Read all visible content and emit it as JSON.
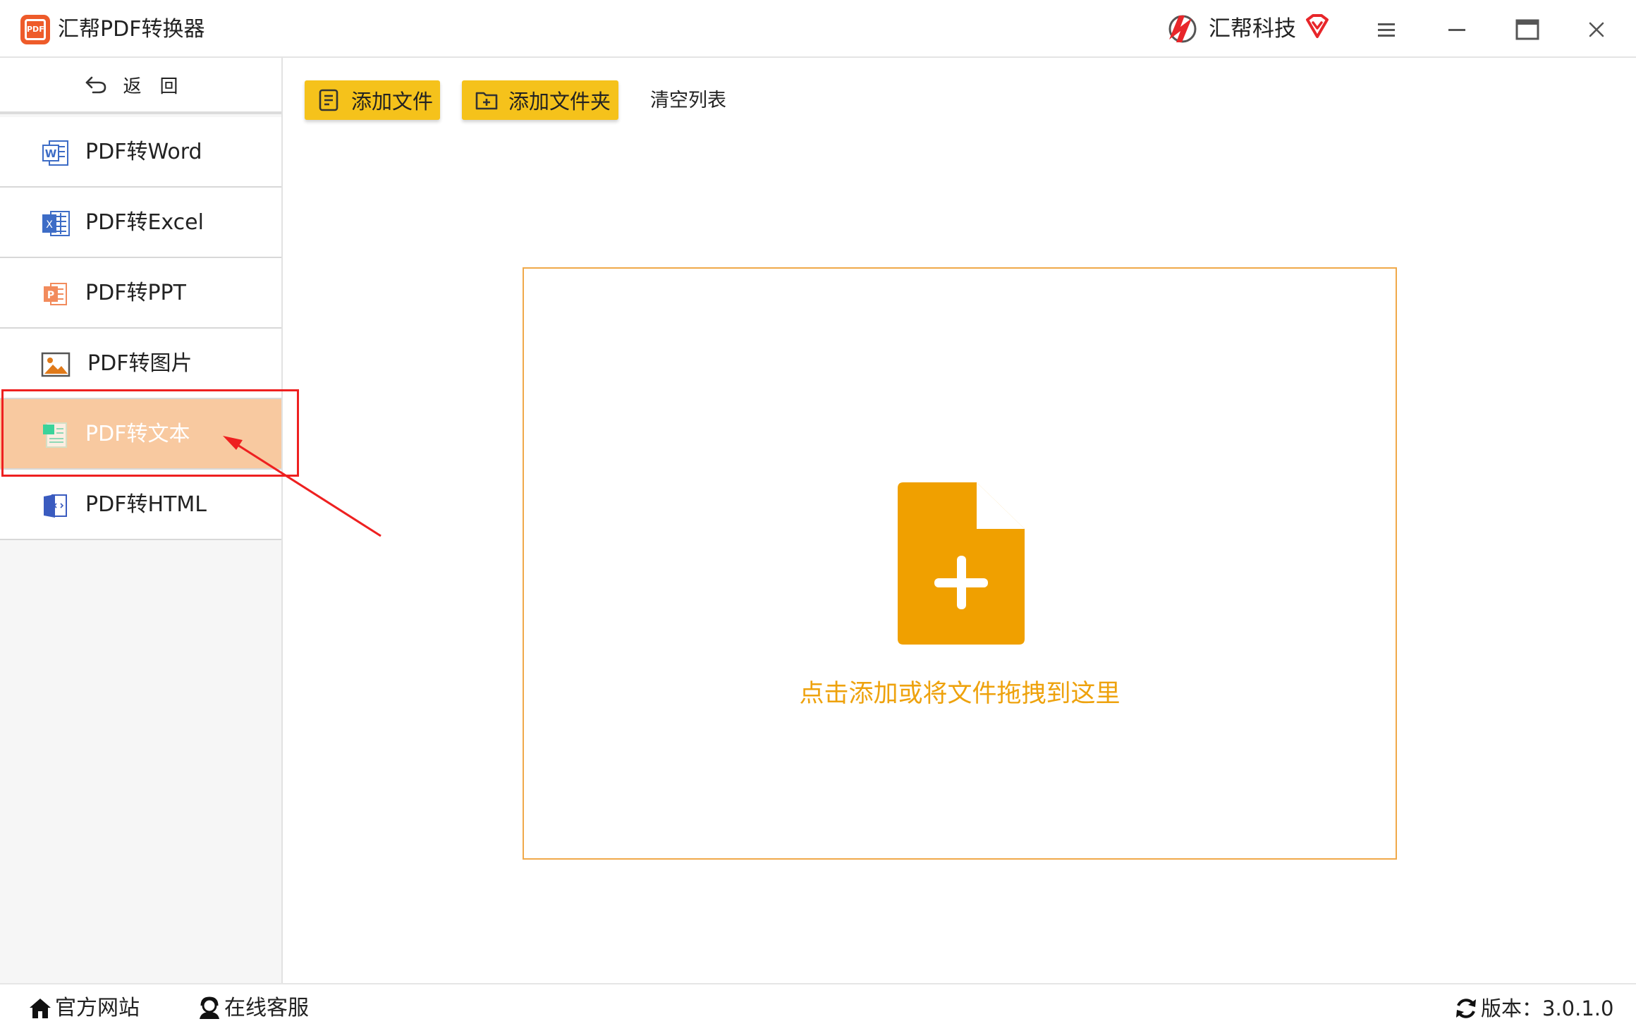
{
  "window": {
    "logo_text": "PDF",
    "title": "汇帮PDF转换器",
    "brand_name": "汇帮科技"
  },
  "sidebar": {
    "back_label": "返回",
    "items": [
      {
        "label": "PDF转Word",
        "icon": "word-icon"
      },
      {
        "label": "PDF转Excel",
        "icon": "excel-icon"
      },
      {
        "label": "PDF转PPT",
        "icon": "ppt-icon"
      },
      {
        "label": "PDF转图片",
        "icon": "image-icon"
      },
      {
        "label": "PDF转文本",
        "icon": "text-icon",
        "active": true
      },
      {
        "label": "PDF转HTML",
        "icon": "html-icon"
      }
    ]
  },
  "toolbar": {
    "add_file_label": "添加文件",
    "add_folder_label": "添加文件夹",
    "clear_label": "清空列表"
  },
  "dropzone": {
    "hint": "点击添加或将文件拖拽到这里"
  },
  "statusbar": {
    "website_label": "官方网站",
    "support_label": "在线客服",
    "version_label": "版本：3.0.1.0"
  },
  "colors": {
    "accent": "#f5c21b",
    "drop_icon": "#f0a000",
    "drop_border": "#f0a94a",
    "active_item": "#f8c9a0",
    "annotation": "#ee2020"
  }
}
